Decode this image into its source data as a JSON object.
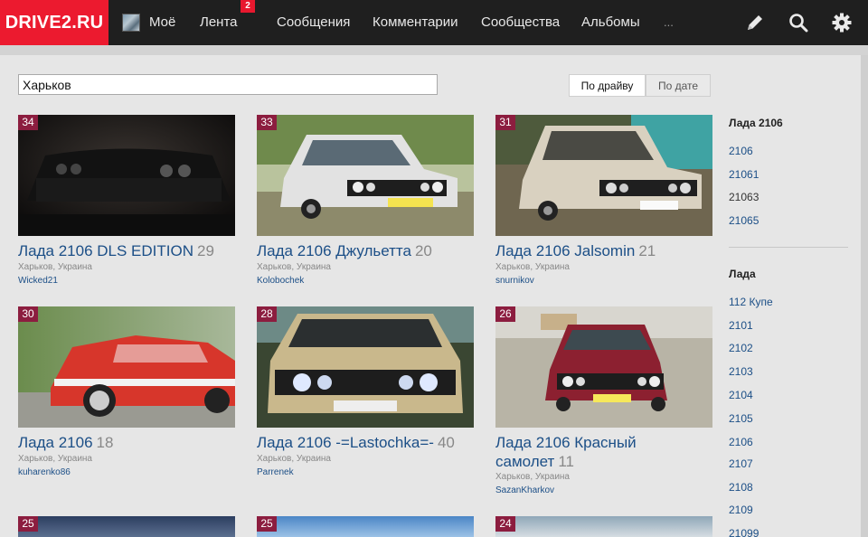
{
  "header": {
    "logo": "DRIVE2.RU",
    "nav": [
      {
        "label": "Моё"
      },
      {
        "label": "Лента",
        "badge": "2"
      },
      {
        "label": "Сообщения"
      },
      {
        "label": "Комментарии"
      },
      {
        "label": "Сообщества"
      },
      {
        "label": "Альбомы"
      },
      {
        "label": "..."
      }
    ],
    "icons": [
      "pencil-icon",
      "search-icon",
      "gear-icon"
    ]
  },
  "search": {
    "value": "Харьков"
  },
  "sort": {
    "active": "По драйву",
    "inactive": "По дате"
  },
  "cards": [
    {
      "rank": "34",
      "title": "Лада 2106 DLS EDITION",
      "count": "29",
      "location": "Харьков, Украина",
      "user": "Wicked21"
    },
    {
      "rank": "33",
      "title": "Лада 2106 Джульетта",
      "count": "20",
      "location": "Харьков, Украина",
      "user": "Kolobochek"
    },
    {
      "rank": "31",
      "title": "Лада 2106 Jalsomin",
      "count": "21",
      "location": "Харьков, Украина",
      "user": "snurnikov"
    },
    {
      "rank": "30",
      "title": "Лада 2106",
      "count": "18",
      "location": "Харьков, Украина",
      "user": "kuharenko86"
    },
    {
      "rank": "28",
      "title": "Лада 2106 -=Lastochka=-",
      "count": "40",
      "location": "Харьков, Украина",
      "user": "Parrenek"
    },
    {
      "rank": "26",
      "title": "Лада 2106 Красный самолет",
      "count": "11",
      "location": "Харьков, Украина",
      "user": "SazanKharkov"
    },
    {
      "rank": "25"
    },
    {
      "rank": "25"
    },
    {
      "rank": "24"
    }
  ],
  "sidebar": {
    "group1": {
      "title": "Лада 2106",
      "items": [
        "2106",
        "21061",
        "21063",
        "21065"
      ]
    },
    "group2": {
      "title": "Лада",
      "items": [
        "112 Купе",
        "2101",
        "2102",
        "2103",
        "2104",
        "2105",
        "2106",
        "2107",
        "2108",
        "2109",
        "21099"
      ]
    }
  },
  "colors": {
    "brand": "#ec1a2f",
    "link": "#1c4f87",
    "rank_badge": "#8c1d3f",
    "topbar": "#1f1f1f"
  }
}
